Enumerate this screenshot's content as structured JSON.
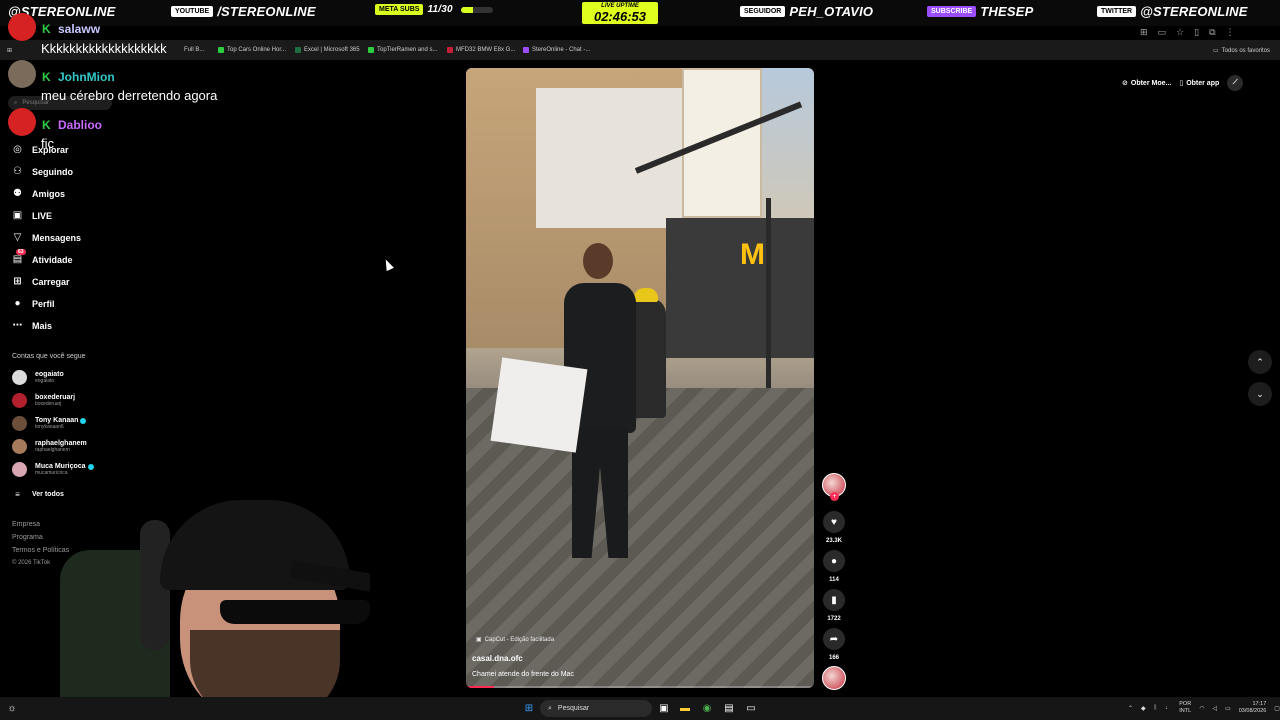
{
  "overlay": {
    "handle_left": "@STEREONLINE",
    "youtube_chip": "YOUTUBE",
    "youtube_handle": "/STEREONLINE",
    "meta_chip": "META SUBS",
    "meta_value": "11/30",
    "meta_progress": 0.37,
    "uptime_label": "LIVE UPTIME",
    "uptime_value": "02:46:53",
    "follower_chip": "SEGUIDOR",
    "follower_name": "PEH_OTAVIO",
    "sub_chip": "SUBSCRIBE",
    "sub_name": "THESEP",
    "twitter_chip": "TWITTER",
    "twitter_handle": "@STEREONLINE"
  },
  "bookmarks": [
    {
      "label": "Full B...",
      "color": "#999999"
    },
    {
      "label": "Top Cars Online Hor...",
      "color": "#2ecc40"
    },
    {
      "label": "Excel | Microsoft 365",
      "color": "#1d6f42"
    },
    {
      "label": "TopTierRamen and s...",
      "color": "#2ecc40"
    },
    {
      "label": "MFD32 BMW E8x G...",
      "color": "#c41e3a"
    },
    {
      "label": "StereOnline - Chat -...",
      "color": "#9b4dff"
    }
  ],
  "bookmarks_right": "Todos os favoritos",
  "chat": [
    {
      "name": "salaww",
      "color": "#c9c9ff",
      "text": "Kkkkkkkkkkkkkkkkkkk"
    },
    {
      "name": "JohnMion",
      "color": "#32c8c8",
      "text": "meu cérebro derretendo agora"
    },
    {
      "name": "Dablioo",
      "color": "#c96bff",
      "text": "fic"
    }
  ],
  "sidebar": {
    "search_placeholder": "Pesquisar",
    "nav": [
      {
        "label": "Explorar",
        "icon": "compass-icon"
      },
      {
        "label": "Seguindo",
        "icon": "user-follow-icon"
      },
      {
        "label": "Amigos",
        "icon": "friends-icon"
      },
      {
        "label": "LIVE",
        "icon": "live-icon"
      },
      {
        "label": "Mensagens",
        "icon": "send-icon"
      },
      {
        "label": "Atividade",
        "icon": "activity-icon",
        "badge": "63"
      },
      {
        "label": "Carregar",
        "icon": "upload-icon"
      },
      {
        "label": "Perfil",
        "icon": "profile-icon"
      },
      {
        "label": "Mais",
        "icon": "more-icon"
      }
    ],
    "following_title": "Contas que você segue",
    "accounts": [
      {
        "name": "eogaiato",
        "handle": "eogaiato",
        "verified": false,
        "color": "#dcdcdc"
      },
      {
        "name": "boxederuarj",
        "handle": "boxederuarj",
        "verified": false,
        "color": "#b1202c"
      },
      {
        "name": "Tony Kanaan",
        "handle": "tonykanaan6",
        "verified": true,
        "color": "#6b4f3a"
      },
      {
        "name": "raphaelghanem",
        "handle": "raphaelghanem",
        "verified": false,
        "color": "#a67b5b"
      },
      {
        "name": "Muca Muriçoca",
        "handle": "mucamuricoca",
        "verified": true,
        "color": "#d9a6b3"
      }
    ],
    "see_all": "Ver todos",
    "footer": [
      "Empresa",
      "Programa",
      "Termos e Políticas",
      "© 2026 TikTok"
    ]
  },
  "video": {
    "capcut": "CapCut - Edição facilitada",
    "author": "casal.dna.ofc",
    "description": "Chamei atende do frente do Mac",
    "progress": 0.08
  },
  "actions": {
    "likes": "23.3K",
    "comments": "114",
    "saves": "1722",
    "shares": "166"
  },
  "top_right": {
    "coins": "Obter Moe...",
    "app": "Obter app"
  },
  "taskbar": {
    "search": "Pesquisar",
    "lang_1": "POR",
    "lang_2": "INTL",
    "time": "17:17",
    "date": "03/08/2026"
  }
}
